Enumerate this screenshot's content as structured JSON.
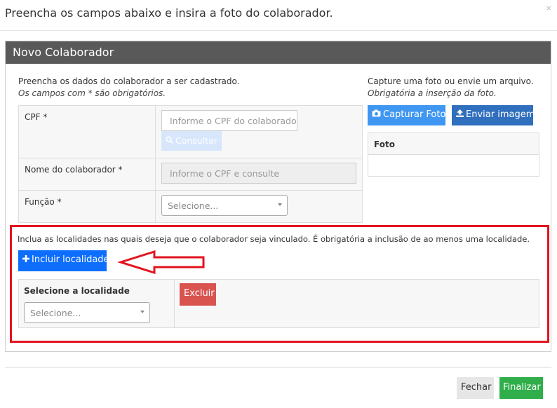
{
  "modal": {
    "title": "Preencha os campos abaixo e insira a foto do colaborador.",
    "close": "×"
  },
  "panel": {
    "title": "Novo Colaborador"
  },
  "form": {
    "intro": "Preencha os dados do colaborador a ser cadastrado.",
    "required_note": "Os campos com * são obrigatórios.",
    "cpf_label": "CPF *",
    "cpf_placeholder": "Informe o CPF do colaborado",
    "consult_label": "Consultar",
    "name_label": "Nome do colaborador *",
    "name_placeholder": "Informe o CPF e consulte",
    "role_label": "Função *",
    "role_selected": "Selecione..."
  },
  "photo": {
    "intro": "Capture uma foto ou envie um arquivo.",
    "required_note": "Obrigatória a inserção da foto.",
    "capture_label": "Capturar Foto",
    "upload_label": "Enviar imagem",
    "box_header": "Foto"
  },
  "locations": {
    "intro": "Inclua as localidades nas quais deseja que o colaborador seja vinculado. É obrigatória a inclusão de ao menos uma localidade.",
    "add_label": "Incluir localidade",
    "column_header": "Selecione a localidade",
    "select_selected": "Selecione...",
    "delete_label": "Excluir"
  },
  "footer": {
    "close_label": "Fechar",
    "finish_label": "Finalizar"
  },
  "colors": {
    "panel_header": "#595959",
    "highlight": "#e2141f",
    "primary": "#0d6efd",
    "danger": "#d9534f",
    "success": "#2fae4a"
  },
  "icons": {
    "consult": "search-icon",
    "capture": "camera-icon",
    "upload": "upload-icon",
    "add": "plus-icon",
    "annotation": "arrow-left-icon"
  }
}
